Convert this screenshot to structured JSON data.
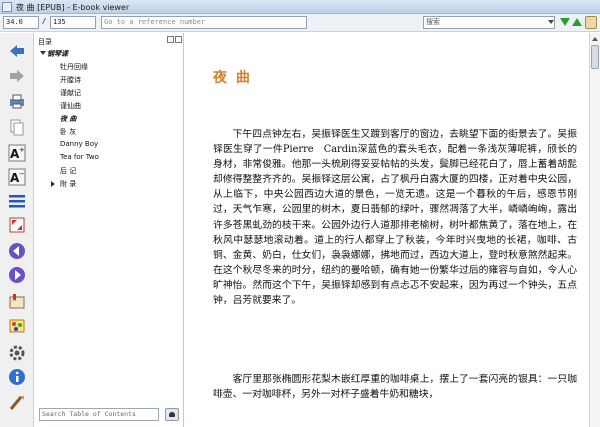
{
  "window": {
    "title": "夜 曲 [EPUB] - E-book viewer"
  },
  "toolbar": {
    "position_value": "34.0",
    "position_sep": "/",
    "position_total": "135",
    "reference_placeholder": "Go to a reference number",
    "search_placeholder": "搜索"
  },
  "tools": [
    "back-icon",
    "forward-icon",
    "print-icon",
    "copy-icon",
    "font-larger-icon",
    "font-smaller-icon",
    "toc-icon",
    "fullscreen-icon",
    "previous-page-icon",
    "next-page-icon",
    "bookmark-icon",
    "theme-icon",
    "preferences-icon",
    "info-icon",
    "lookup-icon"
  ],
  "toc": {
    "header": "目录",
    "search_placeholder": "Search Table of Contents",
    "items": [
      {
        "label": "钢琴课",
        "bold": true
      },
      {
        "label": "牡丹回缘"
      },
      {
        "label": "开膛诗"
      },
      {
        "label": "谨献记"
      },
      {
        "label": "谨仙曲"
      },
      {
        "label": "夜 曲",
        "current": true
      },
      {
        "label": "卧 灰"
      },
      {
        "label": "Danny Boy"
      },
      {
        "label": "Tea for Two"
      },
      {
        "label": "后 记"
      },
      {
        "label": "附 录",
        "expandable": true
      }
    ]
  },
  "reader": {
    "chapter_title": "夜 曲",
    "paragraph_1": "下午四点钟左右，吴振铎医生又踱到客厅的窗边，去眺望下面的街景去了。吴振铎医生穿了一件Pierre　Cardin深蓝色的套头毛衣，配着一条浅灰薄呢裤，颀长的身材，非常俊雅。他那一头梳刷得妥妥帖帖的头发，鬓脚已经花白了，唇上蓄着胡髭却修得整整齐齐的。吴振铎这层公寓，占了枫丹白露大厦的四楼，正对着中央公园，从上临下，中央公园西边大道的景色，一览无遗。这是一个暮秋的午后，感恩节刚过，天气乍寒，公园里的树木，夏日翡郁的绿叶，骤然凋落了大半，嶙嶙峋峋，露出许多苍黑虬劲的枝干来。公园外边行人道那排老榆树，树叶都焦黄了，落在地上，在秋风中瑟瑟地滚动着。道上的行人都穿上了秋装，今年时兴曳地的长裙，咖啡、古铜、金黄、奶白，仕女们，袅袅娜娜，拂地而过，西边大道上，登时秋意煞然起来。在这个秋尽冬来的时分，纽约的曼哈顿，确有她一份繁华过后的雍容与自如，令人心旷神怡。然而这个下午，吴振铎却感到有点忐忑不安起来，因为再过一个钟头，五点钟，吕芳就要来了。",
    "paragraph_2": "客厅里那张椭圆形花梨木嵌红厚重的咖啡桌上，摆上了一套闪亮的银具：一只咖啡壶、一对咖啡杯，另外一对杯子盛着牛奶和糖块，"
  },
  "colors": {
    "chapter_title": "#d2822a",
    "find_arrows": "#2e9b2e"
  }
}
